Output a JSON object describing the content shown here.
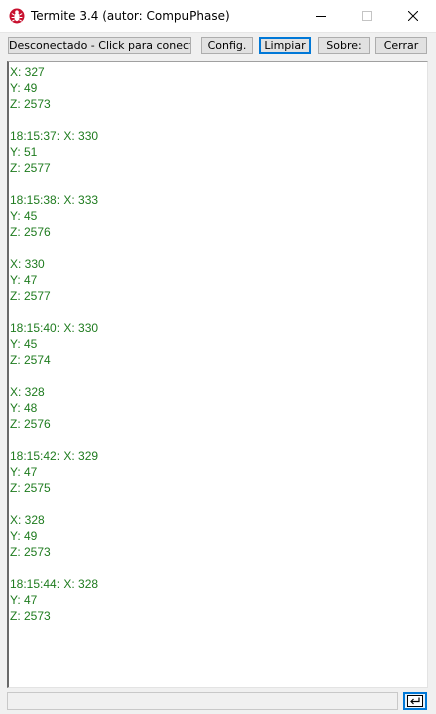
{
  "window": {
    "title": "Termite 3.4 (autor: CompuPhase)",
    "app_icon": "termite-app-icon",
    "controls": [
      "minimize-icon",
      "maximize-icon",
      "close-icon"
    ]
  },
  "toolbar": {
    "connect_label": "Desconectado - Click para conectar",
    "config_label": "Config.",
    "clear_label": "Limpiar",
    "about_label": "Sobre:",
    "close_label": "Cerrar"
  },
  "output": {
    "text_color": "#1e7b1e",
    "lines": [
      "X: 327",
      "Y: 49",
      "Z: 2573",
      "",
      "18:15:37: X: 330",
      "Y: 51",
      "Z: 2577",
      "",
      "18:15:38: X: 333",
      "Y: 45",
      "Z: 2576",
      "",
      "X: 330",
      "Y: 47",
      "Z: 2577",
      "",
      "18:15:40: X: 330",
      "Y: 45",
      "Z: 2574",
      "",
      "X: 328",
      "Y: 48",
      "Z: 2576",
      "",
      "18:15:42: X: 329",
      "Y: 47",
      "Z: 2575",
      "",
      "X: 328",
      "Y: 49",
      "Z: 2573",
      "",
      "18:15:44: X: 328",
      "Y: 47",
      "Z: 2573"
    ]
  },
  "input": {
    "value": "",
    "send_icon": "enter-return-icon"
  },
  "colors": {
    "focus_border": "#0078d7",
    "close_glyph": "#000000",
    "app_icon_red": "#c8102e"
  }
}
